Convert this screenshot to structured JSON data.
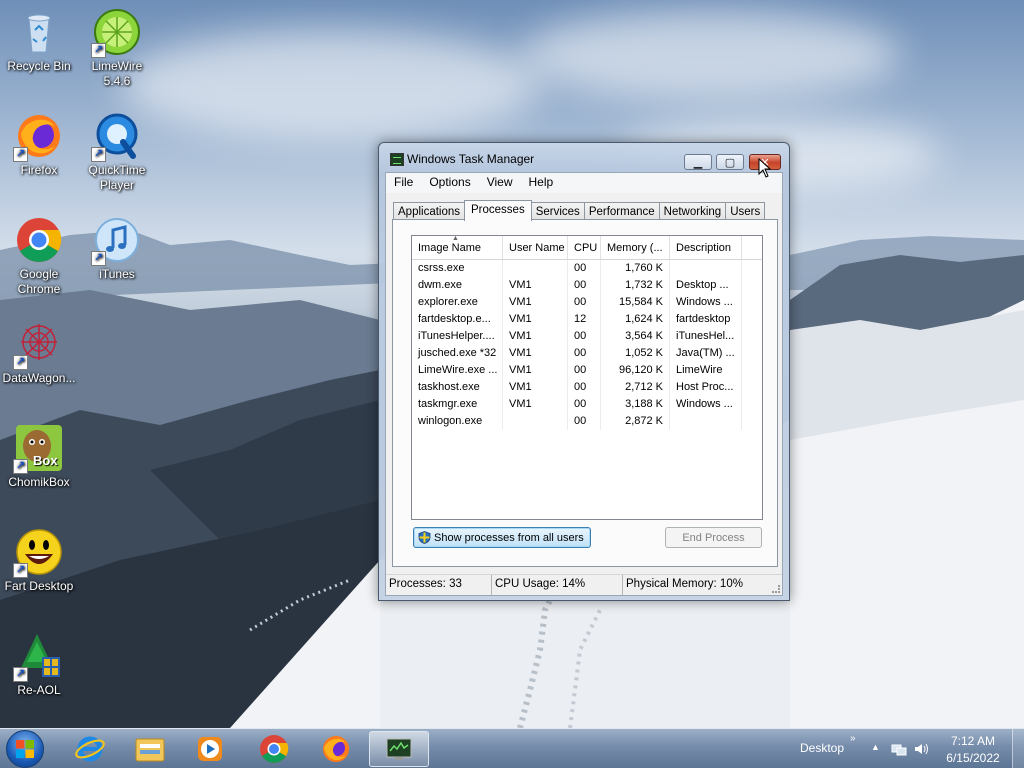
{
  "desktop": {
    "icons": [
      {
        "label": "Recycle Bin",
        "icon": "recycle-bin-icon"
      },
      {
        "label": "LimeWire 5.4.6",
        "icon": "limewire-icon"
      },
      {
        "label": "Firefox",
        "icon": "firefox-icon"
      },
      {
        "label": "QuickTime Player",
        "icon": "quicktime-icon"
      },
      {
        "label": "Google Chrome",
        "icon": "chrome-icon"
      },
      {
        "label": "iTunes",
        "icon": "itunes-icon"
      },
      {
        "label": "DataWagon...",
        "icon": "datawagon-icon"
      },
      {
        "label": "ChomikBox",
        "icon": "chomikbox-icon"
      },
      {
        "label": "Fart Desktop",
        "icon": "fart-desktop-icon"
      },
      {
        "label": "Re-AOL",
        "icon": "re-aol-icon"
      }
    ],
    "chomikbox_badge": "Box"
  },
  "task_manager": {
    "title": "Windows Task Manager",
    "caption_buttons": {
      "minimize": "▁",
      "maximize": "▢",
      "close": "✕"
    },
    "menu": [
      "File",
      "Options",
      "View",
      "Help"
    ],
    "tabs": [
      "Applications",
      "Processes",
      "Services",
      "Performance",
      "Networking",
      "Users"
    ],
    "active_tab": "Processes",
    "columns": [
      "Image Name",
      "User Name",
      "CPU",
      "Memory (...",
      "Description"
    ],
    "sort_indicator": "▲",
    "processes": [
      [
        "csrss.exe",
        "",
        "00",
        "1,760 K",
        ""
      ],
      [
        "dwm.exe",
        "VM1",
        "00",
        "1,732 K",
        "Desktop ..."
      ],
      [
        "explorer.exe",
        "VM1",
        "00",
        "15,584 K",
        "Windows ..."
      ],
      [
        "fartdesktop.e...",
        "VM1",
        "12",
        "1,624 K",
        "fartdesktop"
      ],
      [
        "iTunesHelper....",
        "VM1",
        "00",
        "3,564 K",
        "iTunesHel..."
      ],
      [
        "jusched.exe *32",
        "VM1",
        "00",
        "1,052 K",
        "Java(TM) ..."
      ],
      [
        "LimeWire.exe ...",
        "VM1",
        "00",
        "96,120 K",
        "LimeWire"
      ],
      [
        "taskhost.exe",
        "VM1",
        "00",
        "2,712 K",
        "Host Proc..."
      ],
      [
        "taskmgr.exe",
        "VM1",
        "00",
        "3,188 K",
        "Windows ..."
      ],
      [
        "winlogon.exe",
        "",
        "00",
        "2,872 K",
        ""
      ]
    ],
    "show_all_button": "Show processes from all users",
    "end_process_button": "End Process",
    "status": {
      "processes": "Processes: 33",
      "cpu": "CPU Usage: 14%",
      "memory": "Physical Memory: 10%"
    }
  },
  "taskbar": {
    "pinned": [
      "start-orb",
      "internet-explorer",
      "windows-explorer",
      "windows-media-player",
      "google-chrome",
      "firefox",
      "task-manager"
    ],
    "tray_desktop_label": "Desktop",
    "tray_chevron": "»",
    "tray_up_arrow": "▲",
    "time": "7:12 AM",
    "date": "6/15/2022"
  },
  "colors": {
    "accent": "#3c7fb1",
    "close_button": "#c8432a",
    "taskbar": "#7890af"
  }
}
